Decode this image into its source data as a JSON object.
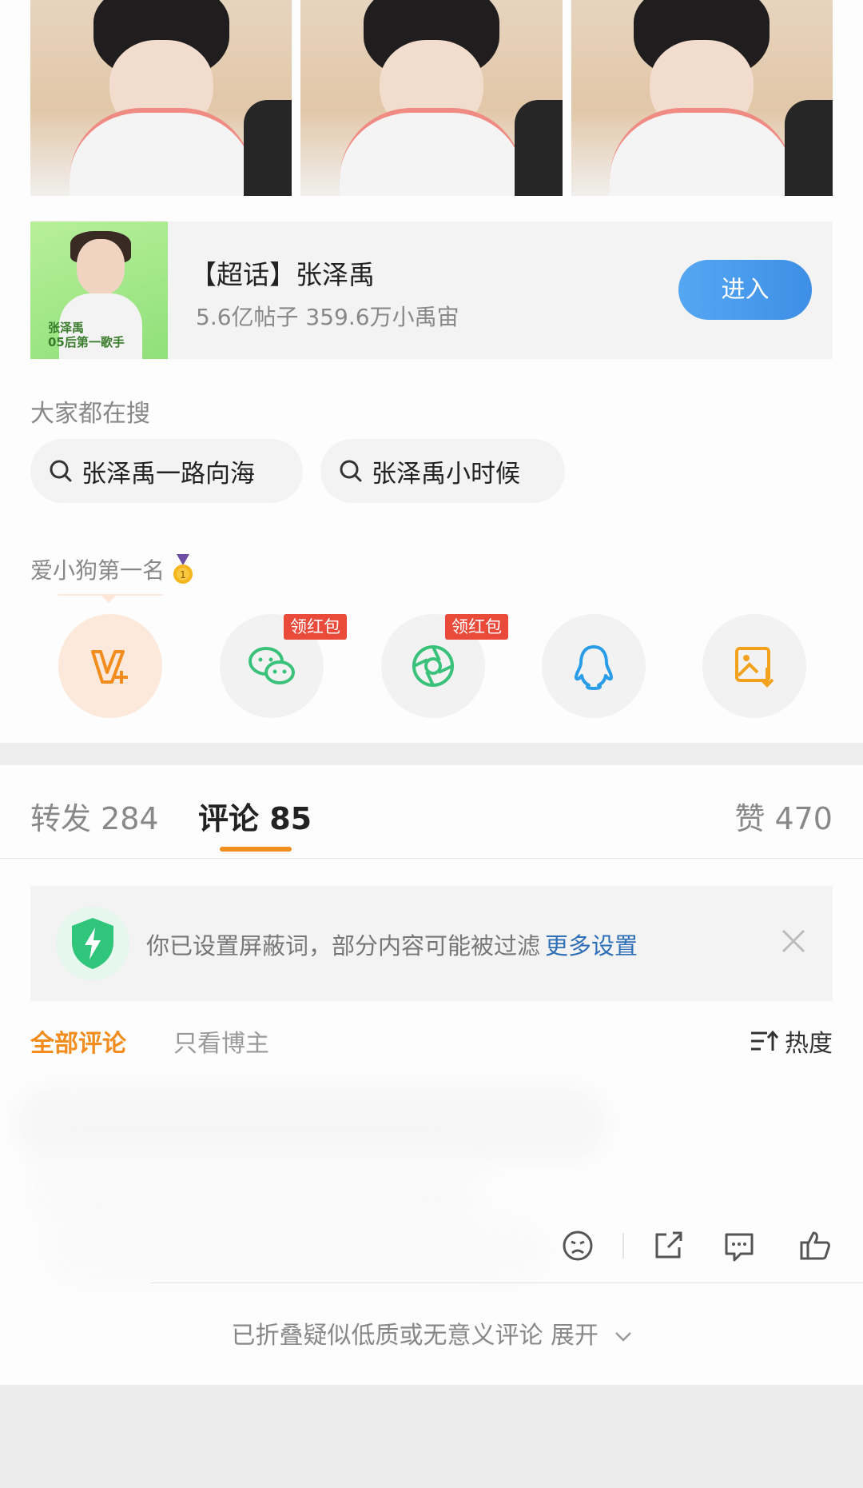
{
  "photos": [
    {
      "alt": "photo-1"
    },
    {
      "alt": "photo-2"
    },
    {
      "alt": "photo-3"
    }
  ],
  "topic": {
    "cover_text": "张泽禹\n05后第一歌手",
    "title": "【超话】张泽禹",
    "subtitle": "5.6亿帖子 359.6万小禹宙",
    "enter_label": "进入"
  },
  "search": {
    "title": "大家都在搜",
    "chips": [
      "张泽禹一路向海",
      "张泽禹小时候"
    ]
  },
  "share": {
    "label": "爱小狗第一名",
    "badge_label": "领红包",
    "targets": [
      {
        "name": "vplus-icon",
        "color": "#f28c1d"
      },
      {
        "name": "wechat-icon",
        "color": "#3ac27a"
      },
      {
        "name": "moments-icon",
        "color": "#3ac27a"
      },
      {
        "name": "qq-icon",
        "color": "#2a9de8"
      },
      {
        "name": "save-image-icon",
        "color": "#f2a21d"
      }
    ]
  },
  "tabs": {
    "repost": "转发 284",
    "comments": "评论 85",
    "likes": "赞 470"
  },
  "notice": {
    "text": "你已设置屏蔽词，部分内容可能被过滤",
    "link": "更多设置"
  },
  "comment_filters": {
    "all": "全部评论",
    "author_only": "只看博主",
    "sort": "热度"
  },
  "folded": {
    "text": "已折叠疑似低质或无意义评论 展开"
  },
  "colors": {
    "accent": "#f28c1d",
    "link": "#2f6fb8",
    "enter_button": "#4a9cec",
    "badge": "#e94a39"
  }
}
